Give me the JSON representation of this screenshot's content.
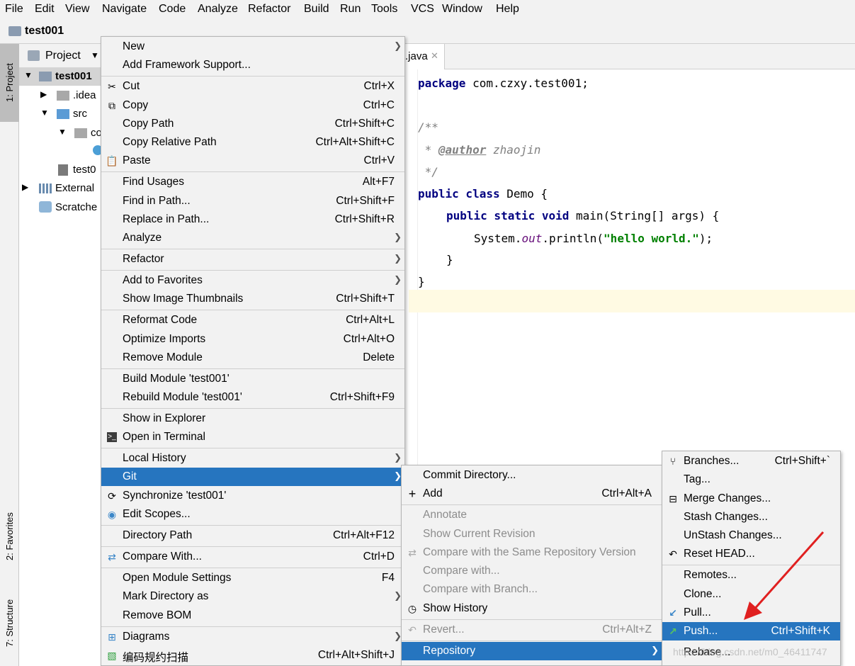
{
  "menubar": {
    "items": [
      "File",
      "Edit",
      "View",
      "Navigate",
      "Code",
      "Analyze",
      "Refactor",
      "Build",
      "Run",
      "Tools",
      "VCS",
      "Window",
      "Help"
    ]
  },
  "navbar": {
    "project": "test001"
  },
  "tool_windows": {
    "project_tab": "1: Project",
    "favorites_tab": "2: Favorites",
    "structure_tab": "7: Structure"
  },
  "project_panel": {
    "title": "Project",
    "tree": [
      "test001",
      ".idea",
      "src",
      "co",
      "test0",
      "External",
      "Scratche"
    ]
  },
  "editor": {
    "tab": ".java",
    "lines": {
      "l1a": "package",
      "l1b": " com.czxy.test001;",
      "l2": "/**",
      "l3a": " * ",
      "l3b": "@author",
      "l3c": " zhaojin",
      "l4": " */",
      "l5a": "public class",
      "l5b": " Demo {",
      "l6a": "public static void",
      "l6b": " main(String[] args) {",
      "l7a": "System.",
      "l7b": "out",
      "l7c": ".println(",
      "l7d": "\"hello world.\"",
      "l7e": ");",
      "l8": "}",
      "l9": "}"
    }
  },
  "context_menu": {
    "items": [
      {
        "label": "New",
        "shortcut": "",
        "sub": true
      },
      {
        "label": "Add Framework Support...",
        "shortcut": ""
      },
      {
        "label": "Cut",
        "shortcut": "Ctrl+X",
        "icon": "scissors-icon"
      },
      {
        "label": "Copy",
        "shortcut": "Ctrl+C",
        "icon": "copy-icon"
      },
      {
        "label": "Copy Path",
        "shortcut": "Ctrl+Shift+C"
      },
      {
        "label": "Copy Relative Path",
        "shortcut": "Ctrl+Alt+Shift+C"
      },
      {
        "label": "Paste",
        "shortcut": "Ctrl+V",
        "icon": "paste-icon"
      },
      {
        "label": "Find Usages",
        "shortcut": "Alt+F7"
      },
      {
        "label": "Find in Path...",
        "shortcut": "Ctrl+Shift+F"
      },
      {
        "label": "Replace in Path...",
        "shortcut": "Ctrl+Shift+R"
      },
      {
        "label": "Analyze",
        "shortcut": "",
        "sub": true
      },
      {
        "label": "Refactor",
        "shortcut": "",
        "sub": true
      },
      {
        "label": "Add to Favorites",
        "shortcut": "",
        "sub": true
      },
      {
        "label": "Show Image Thumbnails",
        "shortcut": "Ctrl+Shift+T"
      },
      {
        "label": "Reformat Code",
        "shortcut": "Ctrl+Alt+L"
      },
      {
        "label": "Optimize Imports",
        "shortcut": "Ctrl+Alt+O"
      },
      {
        "label": "Remove Module",
        "shortcut": "Delete"
      },
      {
        "label": "Build Module 'test001'",
        "shortcut": ""
      },
      {
        "label": "Rebuild Module 'test001'",
        "shortcut": "Ctrl+Shift+F9"
      },
      {
        "label": "Show in Explorer",
        "shortcut": ""
      },
      {
        "label": "Open in Terminal",
        "shortcut": "",
        "icon": "terminal-icon"
      },
      {
        "label": "Local History",
        "shortcut": "",
        "sub": true
      },
      {
        "label": "Git",
        "shortcut": "",
        "sub": true,
        "selected": true
      },
      {
        "label": "Synchronize 'test001'",
        "shortcut": "",
        "icon": "sync-icon"
      },
      {
        "label": "Edit Scopes...",
        "shortcut": "",
        "icon": "scope-icon"
      },
      {
        "label": "Directory Path",
        "shortcut": "Ctrl+Alt+F12"
      },
      {
        "label": "Compare With...",
        "shortcut": "Ctrl+D",
        "icon": "compare-icon"
      },
      {
        "label": "Open Module Settings",
        "shortcut": "F4"
      },
      {
        "label": "Mark Directory as",
        "shortcut": "",
        "sub": true
      },
      {
        "label": "Remove BOM",
        "shortcut": ""
      },
      {
        "label": "Diagrams",
        "shortcut": "",
        "sub": true,
        "icon": "diagram-icon"
      },
      {
        "label": "编码规约扫描",
        "shortcut": "Ctrl+Alt+Shift+J",
        "icon": "scan-icon"
      }
    ]
  },
  "git_menu": {
    "items": [
      {
        "label": "Commit Directory...",
        "shortcut": ""
      },
      {
        "label": "Add",
        "shortcut": "Ctrl+Alt+A",
        "icon": "plus-icon"
      },
      {
        "label": "Annotate",
        "shortcut": "",
        "disabled": true
      },
      {
        "label": "Show Current Revision",
        "shortcut": "",
        "disabled": true
      },
      {
        "label": "Compare with the Same Repository Version",
        "shortcut": "",
        "disabled": true,
        "icon": "compare-icon"
      },
      {
        "label": "Compare with...",
        "shortcut": "",
        "disabled": true
      },
      {
        "label": "Compare with Branch...",
        "shortcut": "",
        "disabled": true
      },
      {
        "label": "Show History",
        "shortcut": "",
        "icon": "clock-icon"
      },
      {
        "label": "Revert...",
        "shortcut": "Ctrl+Alt+Z",
        "disabled": true,
        "icon": "revert-icon"
      },
      {
        "label": "Repository",
        "shortcut": "",
        "sub": true,
        "selected": true
      }
    ]
  },
  "repo_menu": {
    "items": [
      {
        "label": "Branches...",
        "shortcut": "Ctrl+Shift+`",
        "icon": "branch-icon"
      },
      {
        "label": "Tag...",
        "shortcut": ""
      },
      {
        "label": "Merge Changes...",
        "shortcut": "",
        "icon": "merge-icon"
      },
      {
        "label": "Stash Changes...",
        "shortcut": ""
      },
      {
        "label": "UnStash Changes...",
        "shortcut": ""
      },
      {
        "label": "Reset HEAD...",
        "shortcut": "",
        "icon": "reset-icon"
      },
      {
        "label": "Remotes...",
        "shortcut": ""
      },
      {
        "label": "Clone...",
        "shortcut": ""
      },
      {
        "label": "Pull...",
        "shortcut": "",
        "icon": "pull-icon"
      },
      {
        "label": "Push...",
        "shortcut": "Ctrl+Shift+K",
        "icon": "push-icon",
        "selected": true
      },
      {
        "label": "Rebase...",
        "shortcut": ""
      }
    ]
  },
  "watermark": "https://blog.csdn.net/m0_46411747",
  "colors": {
    "selection": "#2675bf",
    "annotation_arrow": "#e02020"
  }
}
